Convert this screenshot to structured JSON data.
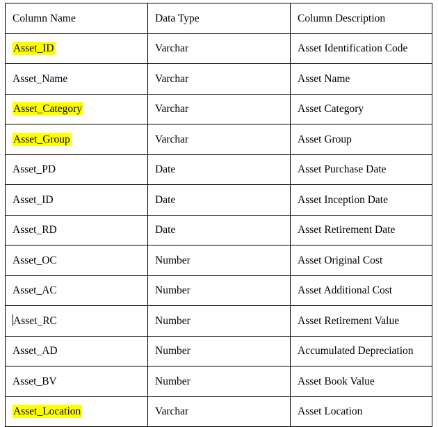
{
  "document": {
    "type": "data-dictionary-table",
    "highlight_color": "#FFFF00",
    "text_color": "#000000",
    "border_color": "#000000",
    "background_color": "#FFFFFF"
  },
  "table": {
    "headers": {
      "column_name": "Column Name",
      "data_type": "Data Type",
      "column_description": "Column Description"
    },
    "rows": [
      {
        "column_name": "Asset_ID",
        "data_type": "Varchar",
        "column_description": "Asset Identification Code",
        "highlighted": true,
        "caret": false
      },
      {
        "column_name": "Asset_Name",
        "data_type": "Varchar",
        "column_description": "Asset Name",
        "highlighted": false,
        "caret": false
      },
      {
        "column_name": "Asset_Category",
        "data_type": "Varchar",
        "column_description": "Asset Category",
        "highlighted": true,
        "caret": false
      },
      {
        "column_name": "Asset_Group",
        "data_type": "Varchar",
        "column_description": "Asset Group",
        "highlighted": true,
        "caret": false
      },
      {
        "column_name": "Asset_PD",
        "data_type": "Date",
        "column_description": "Asset Purchase Date",
        "highlighted": false,
        "caret": false
      },
      {
        "column_name": "Asset_ID",
        "data_type": "Date",
        "column_description": "Asset Inception Date",
        "highlighted": false,
        "caret": false
      },
      {
        "column_name": "Asset_RD",
        "data_type": "Date",
        "column_description": "Asset Retirement Date",
        "highlighted": false,
        "caret": false
      },
      {
        "column_name": "Asset_OC",
        "data_type": "Number",
        "column_description": "Asset Original Cost",
        "highlighted": false,
        "caret": false
      },
      {
        "column_name": "Asset_AC",
        "data_type": "Number",
        "column_description": "Asset Additional Cost",
        "highlighted": false,
        "caret": false
      },
      {
        "column_name": "Asset_RC",
        "data_type": "Number",
        "column_description": "Asset Retirement Value",
        "highlighted": false,
        "caret": true
      },
      {
        "column_name": "Asset_AD",
        "data_type": "Number",
        "column_description": "Accumulated Depreciation",
        "highlighted": false,
        "caret": false
      },
      {
        "column_name": "Asset_BV",
        "data_type": "Number",
        "column_description": "Asset Book Value",
        "highlighted": false,
        "caret": false
      },
      {
        "column_name": "Asset_Location",
        "data_type": "Varchar",
        "column_description": "Asset Location",
        "highlighted": true,
        "caret": false
      }
    ]
  }
}
